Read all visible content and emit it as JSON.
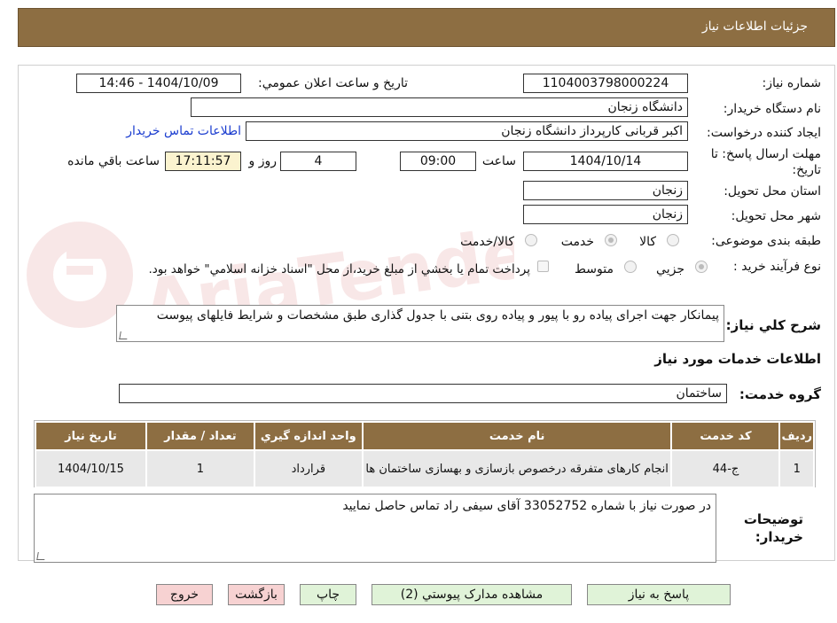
{
  "header": {
    "title": "جزئيات اطلاعات نياز"
  },
  "fields": {
    "need_number_label": "شماره نياز:",
    "need_number": "1104003798000224",
    "announce_label": "تاريخ و ساعت اعلان عمومي:",
    "announce_value": "1404/10/09 - 14:46",
    "buyer_org_label": "نام دستگاه خريدار:",
    "buyer_org": "دانشگاه زنجان",
    "requester_label": "ايجاد کننده درخواست:",
    "requester": "اکبر قربانی کارپرداز دانشگاه زنجان",
    "contact_link": "اطلاعات تماس خريدار",
    "deadline_label": "مهلت ارسال پاسخ: تا",
    "deadline_label2": "تاريخ:",
    "deadline_date": "1404/10/14",
    "time_label": "ساعت",
    "deadline_time": "09:00",
    "days_value": "4",
    "days_label": "روز و",
    "remaining_time": "17:11:57",
    "remaining_label": "ساعت باقي مانده",
    "province_label": "استان محل تحويل:",
    "province": "زنجان",
    "city_label": "شهر محل تحويل:",
    "city": "زنجان",
    "category_label": "طبقه بندی موضوعی:",
    "category_options": [
      "کالا",
      "خدمت",
      "کالا/خدمت"
    ],
    "category_selected": "خدمت",
    "process_label": "نوع فرآیند خرید :",
    "process_options": [
      "جزيي",
      "متوسط"
    ],
    "process_selected": "جزيي",
    "payment_note": "پرداخت تمام يا بخشي از مبلغ خريد،از محل \"اسناد خزانه اسلامي\" خواهد بود.",
    "description_label": "شرح کلي نياز:",
    "description": "پیمانکار جهت اجرای پیاده رو با پیور و پیاده روی بتنی با جدول گذاری طبق مشخصات و شرایط فایلهای پیوست"
  },
  "services": {
    "section_title": "اطلاعات خدمات مورد نياز",
    "group_label": "گروه خدمت:",
    "group_value": "ساختمان",
    "columns": [
      "رديف",
      "کد خدمت",
      "نام خدمت",
      "واحد اندازه گيري",
      "تعداد / مقدار",
      "تاريخ نياز"
    ],
    "rows": [
      [
        "1",
        "ج-44",
        "انجام کارهای متفرقه درخصوص بازسازی و بهسازی ساختمان ها",
        "قرارداد",
        "1",
        "1404/10/15"
      ]
    ]
  },
  "buyer_notes": {
    "label_line1": "توضيحات",
    "label_line2": "خريدار:",
    "text": "در صورت نیاز با شماره 33052752 آقای سیفی راد تماس حاصل نمایید"
  },
  "buttons": {
    "reply": "پاسخ به نياز",
    "attachments": "مشاهده مدارک پيوستي (2)",
    "print": "چاپ",
    "back": "بازگشت",
    "exit": "خروج"
  },
  "watermark": {
    "text": "AriaTender.neT"
  },
  "colors": {
    "header_bg": "#8d6e42",
    "button_green": "#e0f3d8",
    "button_pink": "#f7d2d2",
    "link": "#1a3ccf",
    "timer_bg": "#fbf3cf"
  }
}
